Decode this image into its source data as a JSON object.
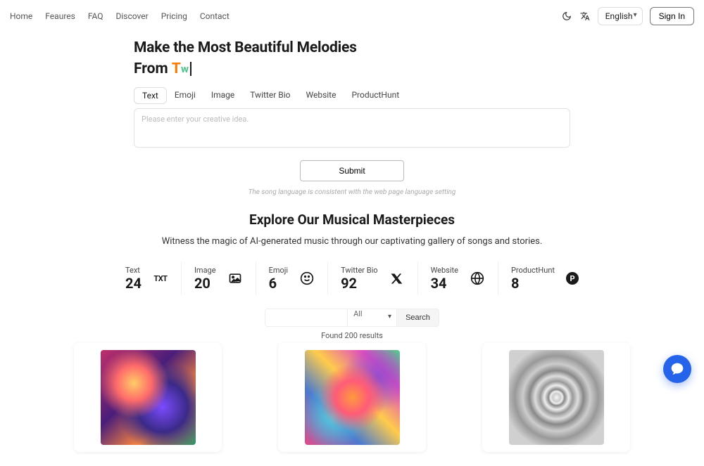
{
  "nav": {
    "home": "Home",
    "features": "Feaures",
    "faq": "FAQ",
    "discover": "Discover",
    "pricing": "Pricing",
    "contact": "Contact"
  },
  "header": {
    "language": "English",
    "signin": "Sign In"
  },
  "hero": {
    "title": "Make the Most Beautiful Melodies",
    "from_label": "From",
    "typed_t": "T",
    "typed_w": "w"
  },
  "tabs": {
    "text": "Text",
    "emoji": "Emoji",
    "image": "Image",
    "twitter": "Twitter Bio",
    "website": "Website",
    "producthunt": "ProductHunt"
  },
  "form": {
    "placeholder": "Please enter your creative idea.",
    "submit": "Submit",
    "hint": "The song language is consistent with the web page language setting"
  },
  "explore": {
    "title": "Explore Our Musical Masterpieces",
    "subtitle": "Witness the magic of AI-generated music through our captivating gallery of songs and stories."
  },
  "stats": {
    "text": {
      "label": "Text",
      "value": "24"
    },
    "image": {
      "label": "Image",
      "value": "20"
    },
    "emoji": {
      "label": "Emoji",
      "value": "6"
    },
    "twitter": {
      "label": "Twitter Bio",
      "value": "92"
    },
    "website": {
      "label": "Website",
      "value": "34"
    },
    "producthunt": {
      "label": "ProductHunt",
      "value": "8"
    }
  },
  "filter": {
    "select": "All",
    "search_btn": "Search",
    "found": "Found 200 results"
  }
}
